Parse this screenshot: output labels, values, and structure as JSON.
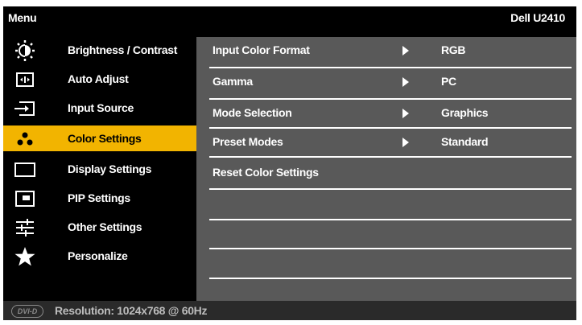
{
  "header": {
    "menu_title": "Menu",
    "model": "Dell U2410"
  },
  "sidebar": {
    "items": [
      {
        "label": "Brightness / Contrast",
        "icon": "sun-icon"
      },
      {
        "label": "Auto Adjust",
        "icon": "auto-adjust-icon"
      },
      {
        "label": "Input Source",
        "icon": "input-source-icon"
      },
      {
        "label": "Color Settings",
        "icon": "color-dots-icon",
        "active": true
      },
      {
        "label": "Display Settings",
        "icon": "display-rectangle-icon"
      },
      {
        "label": "PIP Settings",
        "icon": "pip-icon"
      },
      {
        "label": "Other Settings",
        "icon": "sliders-icon"
      },
      {
        "label": "Personalize",
        "icon": "star-icon"
      }
    ]
  },
  "main": {
    "rows": [
      {
        "label": "Input Color Format",
        "value": "RGB"
      },
      {
        "label": "Gamma",
        "value": "PC"
      },
      {
        "label": "Mode Selection",
        "value": "Graphics"
      },
      {
        "label": "Preset Modes",
        "value": "Standard"
      },
      {
        "label": "Reset Color Settings"
      }
    ]
  },
  "footer": {
    "badge": "DVI-D",
    "resolution": "Resolution: 1024x768 @ 60Hz"
  },
  "colors": {
    "active": "#f2b400",
    "panel": "#595959",
    "background": "#000000"
  }
}
